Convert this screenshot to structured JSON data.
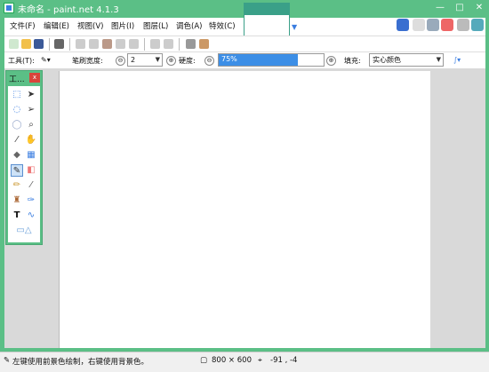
{
  "window": {
    "title": "未命名 - paint.net 4.1.3",
    "minimize": "—",
    "maximize": "□",
    "close": "✕"
  },
  "menu": {
    "items": [
      "文件(F)",
      "编辑(E)",
      "视图(V)",
      "图片(I)",
      "图层(L)",
      "调色(A)",
      "特效(C)"
    ]
  },
  "toolbar": {
    "tool_label": "工具(T):",
    "brush_width_label": "笔刷宽度:",
    "brush_width_value": "2",
    "hardness_label": "硬度:",
    "hardness_value": "75%",
    "hardness_fraction": 0.75,
    "fill_label": "填充:",
    "fill_value": "实心颜色",
    "minus": "⊖",
    "plus": "⊕"
  },
  "tools_window": {
    "title": "工...",
    "close": "x",
    "selected_tool": "paintbrush"
  },
  "canvas": {
    "background": "#ffffff"
  },
  "status": {
    "hint": "左键使用前景色绘制，右键使用背景色。",
    "image_size": "800 × 600",
    "cursor_pos": "-91 , -4"
  },
  "colors": {
    "accent": "#5bbf86",
    "selection": "#3c8ee6"
  }
}
